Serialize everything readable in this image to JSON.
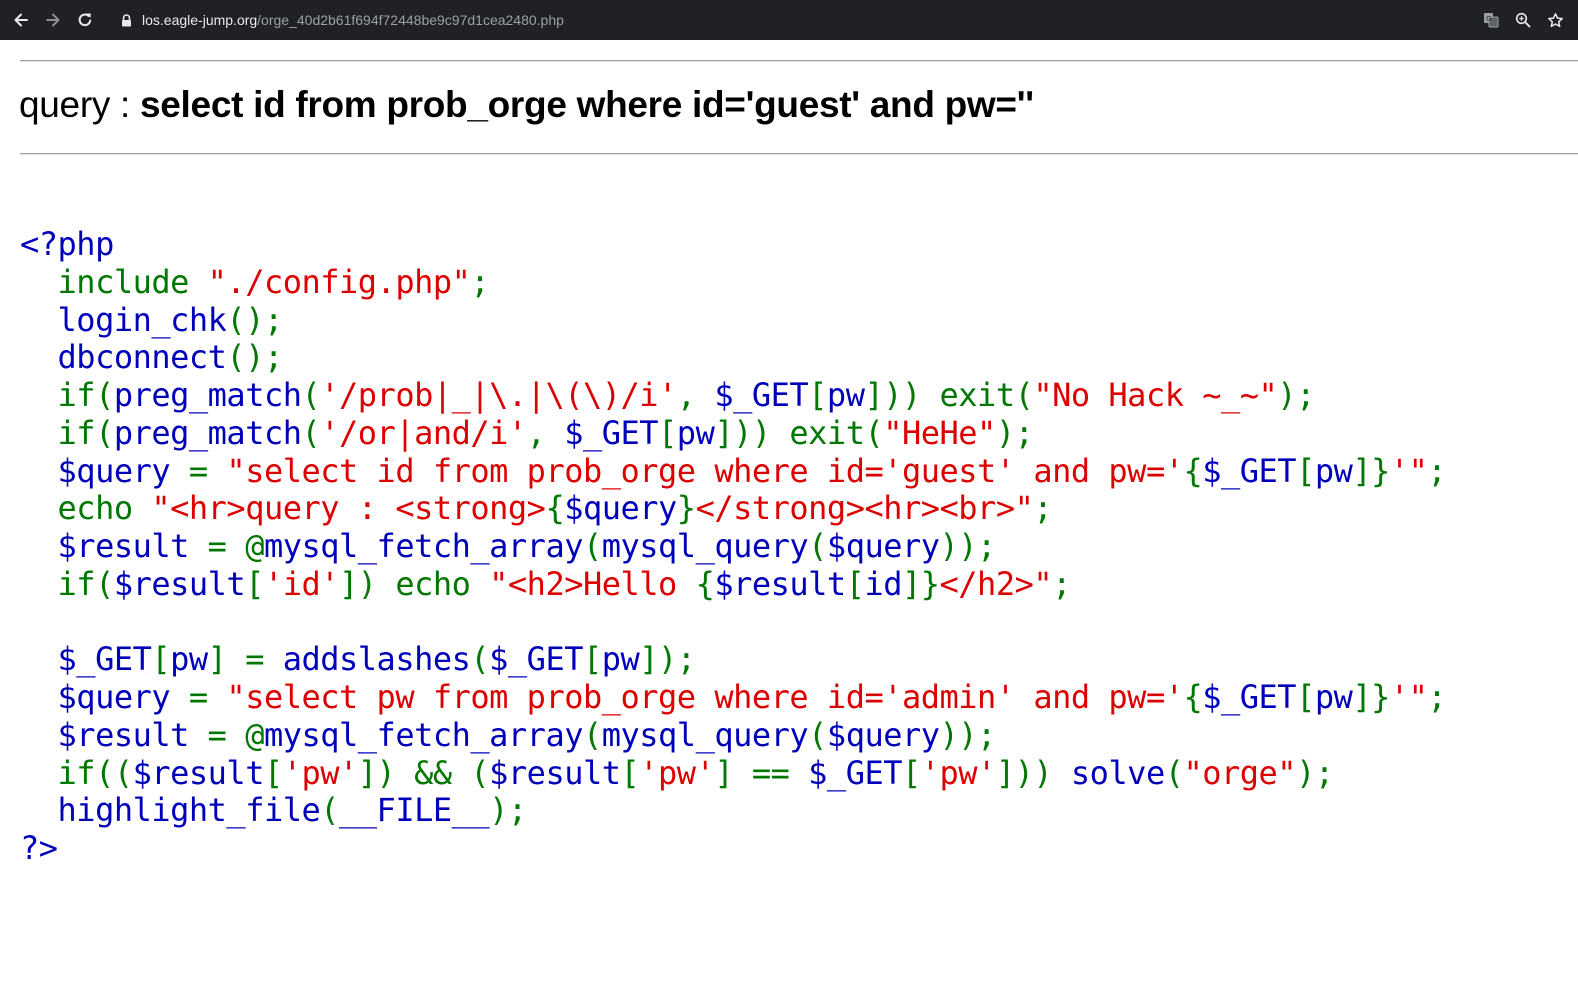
{
  "browser": {
    "url_host": "los.eagle-jump.org",
    "url_path": "/orge_40d2b61f694f72448be9c97d1cea2480.php",
    "icons": [
      "back-arrow-icon",
      "forward-arrow-icon",
      "reload-icon",
      "lock-icon",
      "translate-icon",
      "zoom-icon",
      "bookmark-star-icon"
    ]
  },
  "page": {
    "query_label": "query : ",
    "query_text": "select id from prob_orge where id='guest' and pw=''"
  },
  "colors": {
    "default": "#0000BB",
    "keyword": "#007700",
    "string": "#DD0000",
    "toolbar_bg": "#202124"
  },
  "source_code": [
    [
      [
        "d",
        "<?php"
      ]
    ],
    [
      [
        "k",
        "  include "
      ],
      [
        "s",
        "\"./config.php\""
      ],
      [
        "k",
        ";"
      ]
    ],
    [
      [
        "d",
        "  login_chk"
      ],
      [
        "k",
        "();"
      ]
    ],
    [
      [
        "d",
        "  dbconnect"
      ],
      [
        "k",
        "();"
      ]
    ],
    [
      [
        "k",
        "  if("
      ],
      [
        "d",
        "preg_match"
      ],
      [
        "k",
        "("
      ],
      [
        "s",
        "'/prob|_|\\.|\\(\\)/i'"
      ],
      [
        "k",
        ", "
      ],
      [
        "d",
        "$_GET"
      ],
      [
        "k",
        "["
      ],
      [
        "d",
        "pw"
      ],
      [
        "k",
        "])) exit("
      ],
      [
        "s",
        "\"No Hack ~_~\""
      ],
      [
        "k",
        ");"
      ]
    ],
    [
      [
        "k",
        "  if("
      ],
      [
        "d",
        "preg_match"
      ],
      [
        "k",
        "("
      ],
      [
        "s",
        "'/or|and/i'"
      ],
      [
        "k",
        ", "
      ],
      [
        "d",
        "$_GET"
      ],
      [
        "k",
        "["
      ],
      [
        "d",
        "pw"
      ],
      [
        "k",
        "])) exit("
      ],
      [
        "s",
        "\"HeHe\""
      ],
      [
        "k",
        ");"
      ]
    ],
    [
      [
        "d",
        "  $query "
      ],
      [
        "k",
        "= "
      ],
      [
        "s",
        "\"select id from prob_orge where id='guest' and pw='"
      ],
      [
        "k",
        "{"
      ],
      [
        "d",
        "$_GET"
      ],
      [
        "k",
        "["
      ],
      [
        "d",
        "pw"
      ],
      [
        "k",
        "]}"
      ],
      [
        "s",
        "'\""
      ],
      [
        "k",
        ";"
      ]
    ],
    [
      [
        "k",
        "  echo "
      ],
      [
        "s",
        "\"<hr>query : <strong>"
      ],
      [
        "k",
        "{"
      ],
      [
        "d",
        "$query"
      ],
      [
        "k",
        "}"
      ],
      [
        "s",
        "</strong><hr><br>\""
      ],
      [
        "k",
        ";"
      ]
    ],
    [
      [
        "d",
        "  $result "
      ],
      [
        "k",
        "= @"
      ],
      [
        "d",
        "mysql_fetch_array"
      ],
      [
        "k",
        "("
      ],
      [
        "d",
        "mysql_query"
      ],
      [
        "k",
        "("
      ],
      [
        "d",
        "$query"
      ],
      [
        "k",
        "));"
      ]
    ],
    [
      [
        "k",
        "  if("
      ],
      [
        "d",
        "$result"
      ],
      [
        "k",
        "["
      ],
      [
        "s",
        "'id'"
      ],
      [
        "k",
        "]) echo "
      ],
      [
        "s",
        "\"<h2>Hello "
      ],
      [
        "k",
        "{"
      ],
      [
        "d",
        "$result"
      ],
      [
        "k",
        "["
      ],
      [
        "d",
        "id"
      ],
      [
        "k",
        "]}"
      ],
      [
        "s",
        "</h2>\""
      ],
      [
        "k",
        ";"
      ]
    ],
    [],
    [
      [
        "d",
        "  $_GET"
      ],
      [
        "k",
        "["
      ],
      [
        "d",
        "pw"
      ],
      [
        "k",
        "] = "
      ],
      [
        "d",
        "addslashes"
      ],
      [
        "k",
        "("
      ],
      [
        "d",
        "$_GET"
      ],
      [
        "k",
        "["
      ],
      [
        "d",
        "pw"
      ],
      [
        "k",
        "]);"
      ]
    ],
    [
      [
        "d",
        "  $query "
      ],
      [
        "k",
        "= "
      ],
      [
        "s",
        "\"select pw from prob_orge where id='admin' and pw='"
      ],
      [
        "k",
        "{"
      ],
      [
        "d",
        "$_GET"
      ],
      [
        "k",
        "["
      ],
      [
        "d",
        "pw"
      ],
      [
        "k",
        "]}"
      ],
      [
        "s",
        "'\""
      ],
      [
        "k",
        ";"
      ]
    ],
    [
      [
        "d",
        "  $result "
      ],
      [
        "k",
        "= @"
      ],
      [
        "d",
        "mysql_fetch_array"
      ],
      [
        "k",
        "("
      ],
      [
        "d",
        "mysql_query"
      ],
      [
        "k",
        "("
      ],
      [
        "d",
        "$query"
      ],
      [
        "k",
        "));"
      ]
    ],
    [
      [
        "k",
        "  if(("
      ],
      [
        "d",
        "$result"
      ],
      [
        "k",
        "["
      ],
      [
        "s",
        "'pw'"
      ],
      [
        "k",
        "]) && ("
      ],
      [
        "d",
        "$result"
      ],
      [
        "k",
        "["
      ],
      [
        "s",
        "'pw'"
      ],
      [
        "k",
        "] == "
      ],
      [
        "d",
        "$_GET"
      ],
      [
        "k",
        "["
      ],
      [
        "s",
        "'pw'"
      ],
      [
        "k",
        "])) "
      ],
      [
        "d",
        "solve"
      ],
      [
        "k",
        "("
      ],
      [
        "s",
        "\"orge\""
      ],
      [
        "k",
        ");"
      ]
    ],
    [
      [
        "d",
        "  highlight_file"
      ],
      [
        "k",
        "("
      ],
      [
        "d",
        "__FILE__"
      ],
      [
        "k",
        ");"
      ]
    ],
    [
      [
        "d",
        "?>"
      ]
    ]
  ]
}
